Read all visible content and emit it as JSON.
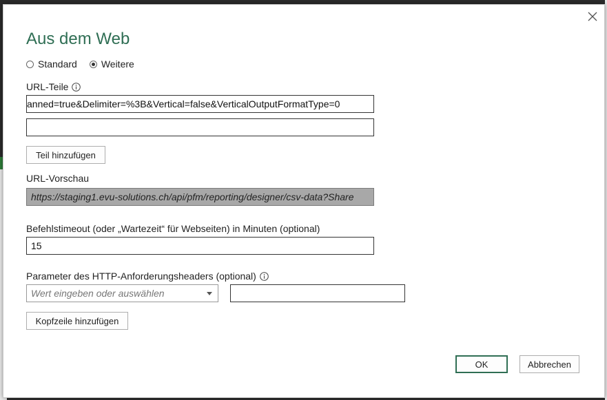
{
  "dialog": {
    "title": "Aus dem Web",
    "close_label": "×"
  },
  "mode": {
    "options": [
      {
        "label": "Standard",
        "checked": false
      },
      {
        "label": "Weitere",
        "checked": true
      }
    ]
  },
  "url_parts": {
    "label": "URL-Teile",
    "part1_value": "anned=true&Delimiter=%3B&Vertical=false&VerticalOutputFormatType=0",
    "part2_value": "",
    "add_part_label": "Teil hinzufügen"
  },
  "url_preview": {
    "label": "URL-Vorschau",
    "value": "https://staging1.evu-solutions.ch/api/pfm/reporting/designer/csv-data?Share"
  },
  "timeout": {
    "label": "Befehlstimeout (oder „Wartezeit“ für Webseiten) in Minuten (optional)",
    "value": "15"
  },
  "headers": {
    "label": "Parameter des HTTP-Anforderungsheaders (optional)",
    "name_placeholder": "Wert eingeben oder auswählen",
    "value": "",
    "add_header_label": "Kopfzeile hinzufügen"
  },
  "actions": {
    "ok_label": "OK",
    "cancel_label": "Abbrechen"
  },
  "colors": {
    "accent": "#2f6e54",
    "preview_bg": "#a8a8a8"
  }
}
